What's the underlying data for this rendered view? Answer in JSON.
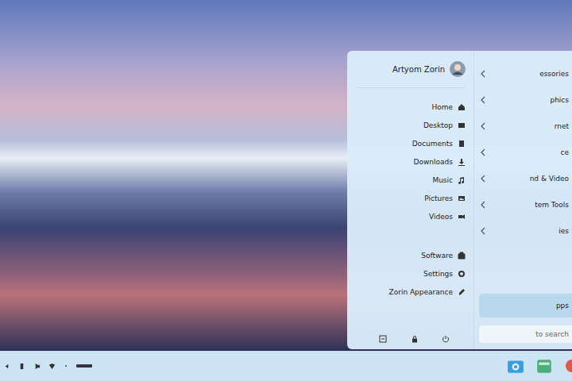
{
  "user": {
    "name": "Artyom Zorin"
  },
  "places": [
    {
      "label": "Home"
    },
    {
      "label": "Desktop"
    },
    {
      "label": "Documents"
    },
    {
      "label": "Downloads"
    },
    {
      "label": "Music"
    },
    {
      "label": "Pictures"
    },
    {
      "label": "Videos"
    }
  ],
  "system": [
    {
      "label": "Software"
    },
    {
      "label": "Settings"
    },
    {
      "label": "Zorin Appearance"
    }
  ],
  "categories": [
    {
      "label": "essories"
    },
    {
      "label": "phics"
    },
    {
      "label": "rnet"
    },
    {
      "label": "ce"
    },
    {
      "label": "nd & Video"
    },
    {
      "label": "tem Tools"
    },
    {
      "label": "ies"
    }
  ],
  "all_apps_button": "pps",
  "search": {
    "placeholder": "to search"
  }
}
